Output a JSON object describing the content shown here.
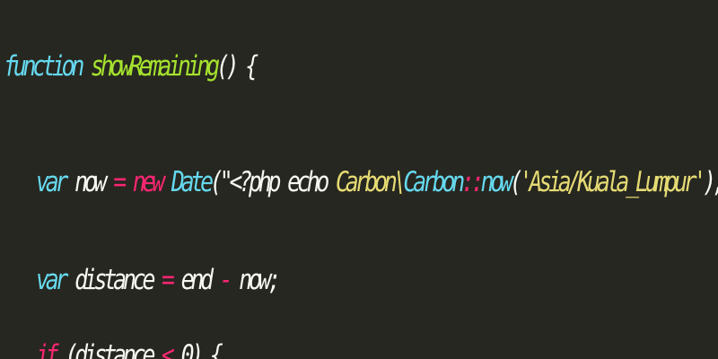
{
  "editor": {
    "theme_colors": {
      "background": "#262720",
      "foreground": "#f8f8f2",
      "keyword": "#66d9ef",
      "function_name": "#a6e22e",
      "operator": "#f92672",
      "string": "#e6db74"
    },
    "lines": [
      {
        "tokens": [
          {
            "type": "keyword",
            "text": "function"
          },
          {
            "type": "plain",
            "text": " "
          },
          {
            "type": "fname",
            "text": "showRemaining"
          },
          {
            "type": "plain",
            "text": "() {"
          }
        ]
      },
      {
        "tokens": [
          {
            "type": "storage",
            "text": "var"
          },
          {
            "type": "plain",
            "text": " now "
          },
          {
            "type": "op",
            "text": "="
          },
          {
            "type": "plain",
            "text": " "
          },
          {
            "type": "new",
            "text": "new"
          },
          {
            "type": "plain",
            "text": " "
          },
          {
            "type": "class",
            "text": "Date"
          },
          {
            "type": "plain",
            "text": "(\""
          },
          {
            "type": "php",
            "text": "<?php echo "
          },
          {
            "type": "string",
            "text": "Carbon\\"
          },
          {
            "type": "class",
            "text": "Carbon"
          },
          {
            "type": "op",
            "text": "::"
          },
          {
            "type": "func",
            "text": "now"
          },
          {
            "type": "plain",
            "text": "("
          },
          {
            "type": "string",
            "text": "'Asia/Kuala_Lumpur'"
          },
          {
            "type": "plain",
            "text": "); ?>\");"
          }
        ]
      },
      {
        "tokens": [
          {
            "type": "storage",
            "text": "var"
          },
          {
            "type": "plain",
            "text": " distance "
          },
          {
            "type": "op",
            "text": "="
          },
          {
            "type": "plain",
            "text": " end "
          },
          {
            "type": "op",
            "text": "-"
          },
          {
            "type": "plain",
            "text": " now;"
          }
        ]
      },
      {
        "tokens": [
          {
            "type": "op",
            "text": "if"
          },
          {
            "type": "plain",
            "text": " (distance "
          },
          {
            "type": "op",
            "text": "<"
          },
          {
            "type": "plain",
            "text": " 0) {"
          }
        ]
      }
    ]
  }
}
